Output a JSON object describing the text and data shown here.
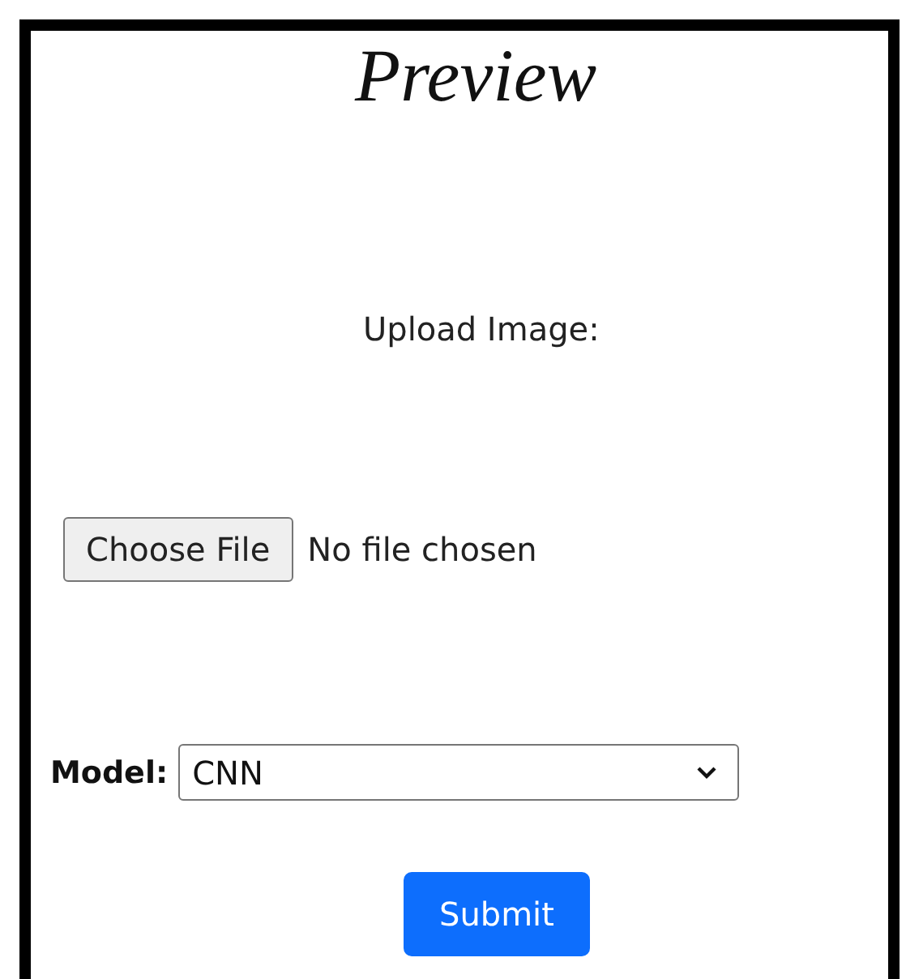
{
  "title": "Preview",
  "upload_label": "Upload Image:",
  "file_input": {
    "button": "Choose File",
    "status": "No file chosen"
  },
  "model": {
    "label": "Model:",
    "value": "CNN"
  },
  "submit": "Submit"
}
